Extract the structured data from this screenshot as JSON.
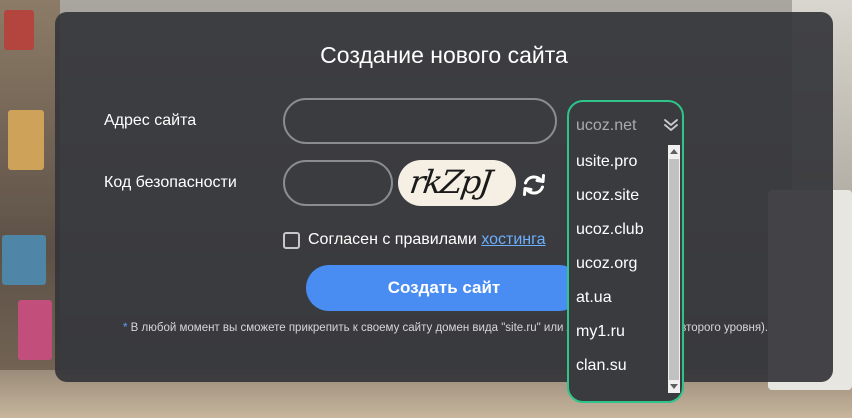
{
  "dialog": {
    "title": "Создание нового сайта",
    "address_label": "Адрес сайта",
    "address_value": "",
    "security_label": "Код безопасности",
    "security_value": "",
    "captcha_text": "rkZpJ",
    "agree_text": "Согласен с правилами ",
    "agree_link": "хостинга",
    "agree_checked": false,
    "create_button": "Создать сайт",
    "note_asterisk": "*",
    "note_text": " В любой момент вы сможете прикрепить к своему сайту домен вида \"site.ru\" или любой другой домен второго уровня)."
  },
  "domain_dropdown": {
    "selected": "ucoz.net",
    "options": [
      "usite.pro",
      "ucoz.site",
      "ucoz.club",
      "ucoz.org",
      "at.ua",
      "my1.ru",
      "clan.su"
    ]
  },
  "icons": {
    "refresh": "refresh-icon",
    "chevron": "chevron-double-down-icon"
  },
  "colors": {
    "accent_blue": "#4a8df2",
    "link_blue": "#6ab0ff",
    "dropdown_border": "#2ec48a",
    "dialog_bg": "#343539"
  }
}
